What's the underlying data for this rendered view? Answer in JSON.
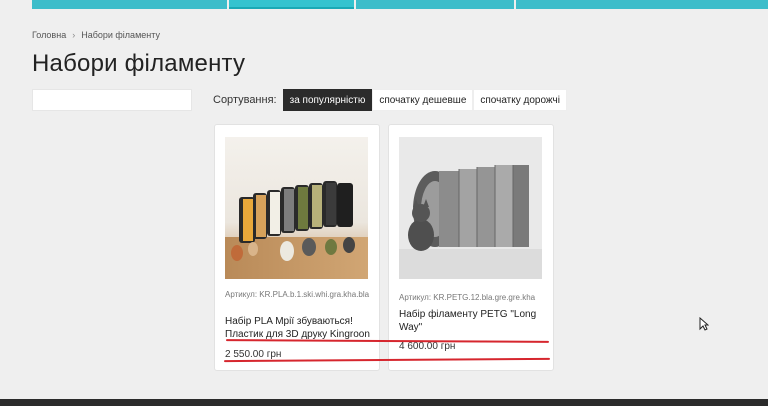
{
  "breadcrumb": {
    "home": "Головна",
    "current": "Набори філаменту"
  },
  "page": {
    "title": "Набори філаменту"
  },
  "sorting": {
    "label": "Сортування:",
    "options": [
      "за популярністю",
      "спочатку дешевше",
      "спочатку дорожчі"
    ],
    "active_index": 0
  },
  "products": [
    {
      "sku": "Артикул: KR.PLA.b.1.ski.whi.gra.kha.bla",
      "name": "Набір PLA Мрії збуваються! Пластик для 3D друку Kingroon",
      "price": "2 550.00 грн"
    },
    {
      "sku": "Артикул: KR.PETG.12.bla.gre.gre.kha",
      "name": "Набір філаменту PETG \"Long Way\"",
      "price": "4 600.00 грн"
    }
  ],
  "colors": {
    "accent": "#3dbdca",
    "active_sort": "#2b2b2b",
    "annotation": "#d6262e"
  }
}
